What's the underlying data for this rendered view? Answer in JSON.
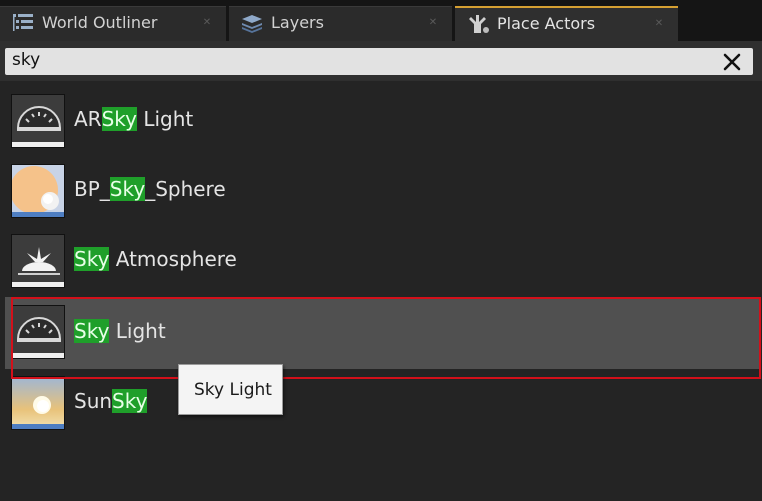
{
  "tabs": [
    {
      "label": "World Outliner",
      "icon": "outliner-icon",
      "active": false
    },
    {
      "label": "Layers",
      "icon": "layers-icon",
      "active": false
    },
    {
      "label": "Place Actors",
      "icon": "place-actors-icon",
      "active": true
    }
  ],
  "search": {
    "value": "sky",
    "clear_icon": "close-icon"
  },
  "items": [
    {
      "pre": "AR",
      "match": "Sky",
      "post": " Light",
      "icon": "sky-light-icon"
    },
    {
      "pre": "BP_",
      "match": "Sky",
      "post": "_Sphere",
      "icon": "sky-sphere-icon"
    },
    {
      "pre": "",
      "match": "Sky",
      "post": " Atmosphere",
      "icon": "sky-atmosphere-icon"
    },
    {
      "pre": "",
      "match": "Sky",
      "post": " Light",
      "icon": "sky-light-icon"
    },
    {
      "pre": "Sun",
      "match": "Sky",
      "post": "",
      "icon": "sunsky-icon"
    }
  ],
  "tooltip": {
    "text": "Sky Light"
  },
  "colors": {
    "highlight": "#1f9f2a",
    "selection": "#d3101a",
    "active_tab": "#d6a032"
  }
}
